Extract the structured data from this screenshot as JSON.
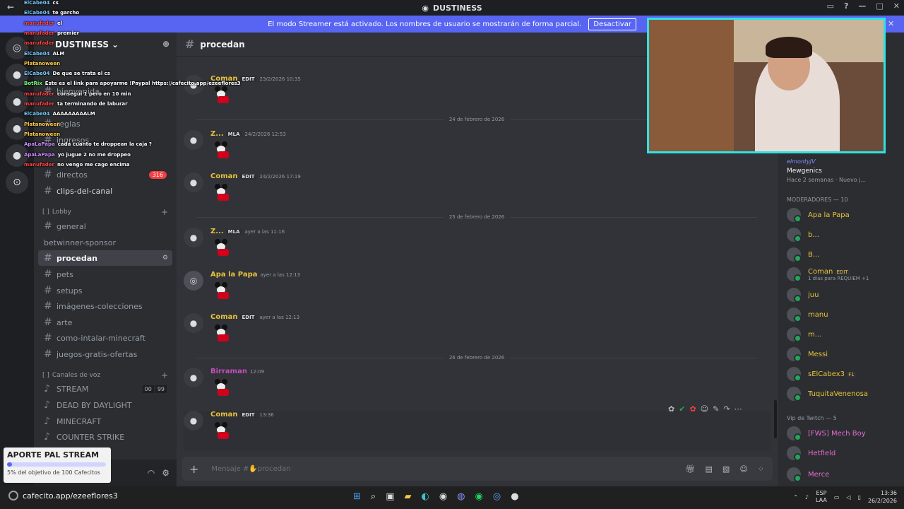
{
  "titlebar": {
    "title": "DUSTINESS"
  },
  "banner": {
    "text": "El modo Streamer está activado. Los nombres de usuario se mostrarán de forma parcial.",
    "button": "Desactivar"
  },
  "sidebar": {
    "server_name": "DUSTINESS",
    "channels": [
      {
        "label": "bienvenida",
        "top": 0
      },
      {
        "label": "reglas",
        "top": 0
      },
      {
        "label": "ingresos",
        "top": 0
      },
      {
        "label": "directos",
        "badge": "316"
      },
      {
        "label": "clips-del-canal"
      }
    ],
    "category_lobby": "Lobby",
    "lobby_channels": [
      "general",
      "betwinner-sponsor",
      "procedan",
      "pets",
      "setups",
      "imágenes-colecciones",
      "arte",
      "como-intalar-minecraft",
      "juegos-gratis-ofertas"
    ],
    "category_voice": "Canales de voz",
    "voice_channels": [
      "STREAM",
      "DEAD BY DAYLIGHT",
      "MINECRAFT",
      "COUNTER STRIKE"
    ],
    "stream_counts": [
      "00",
      "99"
    ]
  },
  "donation": {
    "title": "APORTE PAL STREAM",
    "subtitle": "5% del objetivo de 100 Cafecitos",
    "progress": 0.05
  },
  "chat": {
    "channel": "procedan",
    "messages": [
      {
        "author": "Coman",
        "tag": "EDIT",
        "time": "23/2/2026 10:35",
        "color": "#e8c33b"
      },
      {
        "author": "Z...",
        "tag": "MLA",
        "time": "24/2/2026 12:53",
        "color": "#e8c33b"
      },
      {
        "author": "Coman",
        "tag": "EDIT",
        "time": "24/2/2026 17:19",
        "color": "#e8c33b"
      },
      {
        "author": "Z...",
        "tag": "MLA",
        "time": "ayer a las 11:16",
        "color": "#e8c33b"
      },
      {
        "author": "Apa la Papa",
        "tag": "",
        "time": "ayer a las 12:13",
        "color": "#e8c33b"
      },
      {
        "author": "Coman",
        "tag": "EDIT",
        "time": "ayer a las 12:13",
        "color": "#e8c33b"
      },
      {
        "author": "Birraman",
        "tag": "",
        "time": "12:09",
        "color": "#c64fbf"
      },
      {
        "author": "Coman",
        "tag": "EDIT",
        "time": "13:36",
        "color": "#e8c33b"
      }
    ],
    "dividers": [
      "24 de febrero de 2026",
      "25 de febrero de 2026",
      "26 de febrero de 2026"
    ],
    "input_placeholder": "Mensaje #✋procedan"
  },
  "members": {
    "activity_user": "elmontyJV",
    "activity_name": "Mewgenics",
    "activity_time": "Hace 2 semanas",
    "activity_new": "Nuevo j...",
    "mods_header": "MODERADORES — 10",
    "mods": [
      {
        "name": "Apa la Papa",
        "color": "#e8c33b"
      },
      {
        "name": "b...",
        "color": "#e8c33b"
      },
      {
        "name": "B...",
        "color": "#e8c33b"
      },
      {
        "name": "Coman",
        "color": "#e8c33b",
        "tag": "EDIT",
        "sub": "1 días para REQUIEM +1"
      },
      {
        "name": "juu",
        "color": "#e8c33b"
      },
      {
        "name": "manu",
        "color": "#e8c33b"
      },
      {
        "name": "m...",
        "color": "#e8c33b"
      },
      {
        "name": "Messi",
        "color": "#e8c33b"
      },
      {
        "name": "sElCabex3",
        "color": "#e8c33b",
        "tag": "F1"
      },
      {
        "name": "TuquitaVenenosa",
        "color": "#e8c33b"
      }
    ],
    "vip_header": "Vip de Twitch — 5",
    "vips": [
      {
        "name": "[FWS] Mech Boy",
        "color": "#e86bd1"
      },
      {
        "name": "Hetfield",
        "color": "#e86bd1"
      },
      {
        "name": "Merce",
        "color": "#e86bd1"
      }
    ]
  },
  "twitch_chat": [
    {
      "user": "ElCabe04",
      "text": "cs",
      "color": "#7cf"
    },
    {
      "user": "ElCabe04",
      "text": "te garcho",
      "color": "#7cf"
    },
    {
      "user": "manufader",
      "text": "el",
      "color": "#f44"
    },
    {
      "user": "manufader",
      "text": "premier",
      "color": "#f44"
    },
    {
      "user": "manufader",
      "text": "",
      "color": "#f44"
    },
    {
      "user": "ElCabe04",
      "text": "ALM",
      "color": "#7cf"
    },
    {
      "user": "Platanoween",
      "text": "",
      "color": "#fc4"
    },
    {
      "user": "ElCabe04",
      "text": "De que se trata el cs",
      "color": "#7cf"
    },
    {
      "user": "BotRix",
      "text": "Este es el link para apoyarme !Paypal https://cafecito.app/ezeeflores3",
      "color": "#7f7"
    },
    {
      "user": "manufader",
      "text": "consegui 1 pero en 10 min",
      "color": "#f44"
    },
    {
      "user": "manufader",
      "text": "ta terminando de laburar",
      "color": "#f44"
    },
    {
      "user": "ElCabe04",
      "text": "AAAAAAAAALM",
      "color": "#7cf"
    },
    {
      "user": "Platanoween",
      "text": "",
      "color": "#fc4"
    },
    {
      "user": "Platanoween",
      "text": "",
      "color": "#fc4"
    },
    {
      "user": "ApaLaPapa",
      "text": "cada cuanto te droppean la caja ?",
      "color": "#c8f"
    },
    {
      "user": "ApaLaPapa",
      "text": "yo jugue 2 no me droppeo",
      "color": "#c8f"
    },
    {
      "user": "manufader",
      "text": "no vengo me cago encima",
      "color": "#f44"
    }
  ],
  "taskbar": {
    "url": "cafecito.app/ezeeflores3",
    "lang": "ESP",
    "layout": "LAA",
    "time": "13:36",
    "date": "26/2/2026"
  },
  "colors": {
    "accent": "#5865f2",
    "webcam_border": "#2ee3e0"
  }
}
